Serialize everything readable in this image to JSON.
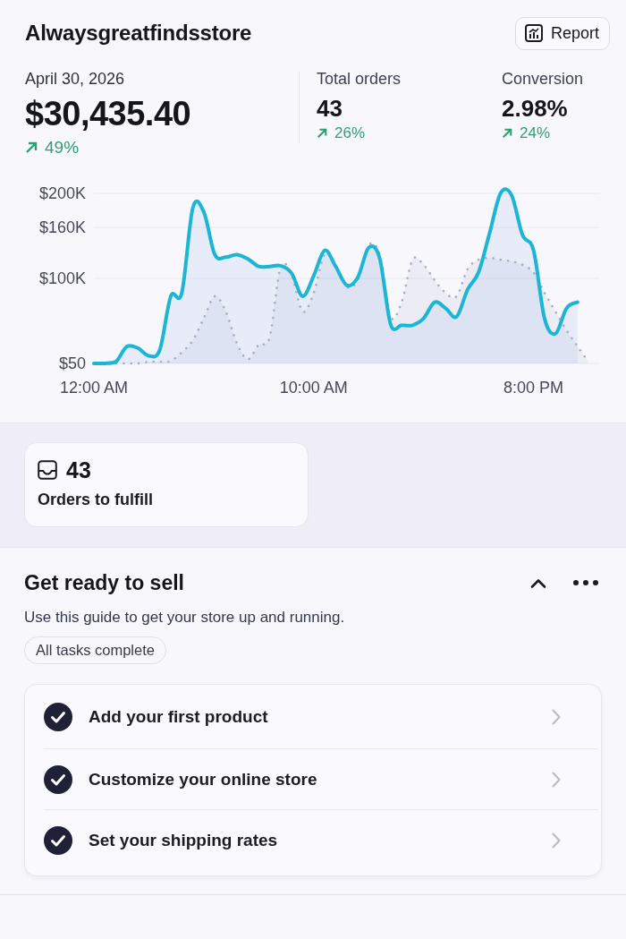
{
  "header": {
    "store_name": "Alwaysgreatfindsstore",
    "report_button": "Report"
  },
  "summary": {
    "date": "April 30, 2026",
    "total_sales": "$30,435.40",
    "sales_change": "49%",
    "metrics": [
      {
        "label": "Total orders",
        "value": "43",
        "change": "26%"
      },
      {
        "label": "Conversion",
        "value": "2.98%",
        "change": "24%"
      }
    ]
  },
  "sales_chart": {
    "chart_data": {
      "type": "area",
      "x": [
        0,
        0.5,
        1,
        1.5,
        2,
        2.5,
        3,
        3.5,
        4,
        4.5,
        5,
        5.5,
        6,
        6.5,
        7,
        7.5,
        8,
        8.5,
        9,
        9.5,
        10,
        10.5,
        11,
        11.5,
        12,
        12.5,
        13,
        13.5,
        14,
        14.5,
        15,
        15.5,
        16,
        16.5,
        17,
        17.5,
        18,
        18.5,
        19,
        19.5,
        20,
        20.5,
        21,
        21.5,
        22,
        22.5
      ],
      "xlim": [
        0,
        23
      ],
      "ylim": [
        0,
        200000
      ],
      "xticks": [
        {
          "value": 0,
          "label": "12:00 AM"
        },
        {
          "value": 10,
          "label": "10:00 AM"
        },
        {
          "value": 20,
          "label": "8:00 PM"
        }
      ],
      "yticks": [
        {
          "value": 50,
          "label": "$50"
        },
        {
          "value": 100000,
          "label": "$100K"
        },
        {
          "value": 160000,
          "label": "$160K"
        },
        {
          "value": 200000,
          "label": "$200K"
        }
      ],
      "grid": true,
      "series": [
        {
          "color": "#1cb6d4",
          "line_style": "solid",
          "values": [
            0,
            0,
            2000,
            20000,
            18000,
            9000,
            16000,
            79000,
            83000,
            183000,
            178000,
            128000,
            125000,
            128000,
            123000,
            114000,
            114000,
            115000,
            106000,
            79000,
            103000,
            133000,
            114000,
            92000,
            101000,
            136000,
            124000,
            46000,
            45000,
            45000,
            53000,
            72000,
            65000,
            55000,
            87000,
            107000,
            153000,
            200000,
            198000,
            151000,
            133000,
            53000,
            35000,
            65000,
            72000,
            null
          ]
        },
        {
          "color": "#a8acba",
          "line_style": "dotted",
          "values": [
            0,
            0,
            0,
            0,
            0,
            2000,
            2000,
            3000,
            13000,
            27000,
            53000,
            79000,
            61000,
            24000,
            5000,
            22000,
            31000,
            114000,
            103000,
            61000,
            83000,
            128000,
            116000,
            90000,
            98000,
            139000,
            128000,
            55000,
            72000,
            122000,
            116000,
            98000,
            83000,
            79000,
            111000,
            122000,
            124000,
            122000,
            120000,
            116000,
            107000,
            83000,
            61000,
            39000,
            20000,
            2000
          ]
        }
      ]
    }
  },
  "orders_card": {
    "count": "43",
    "label": "Orders to fulfill"
  },
  "setup_guide": {
    "title": "Get ready to sell",
    "expanded": true,
    "description": "Use this guide to get your store up and running.",
    "status": "All tasks complete",
    "tasks": [
      {
        "label": "Add your first product",
        "checked": true
      },
      {
        "label": "Customize your online store",
        "checked": true
      },
      {
        "label": "Set your shipping rates",
        "checked": true
      }
    ]
  }
}
